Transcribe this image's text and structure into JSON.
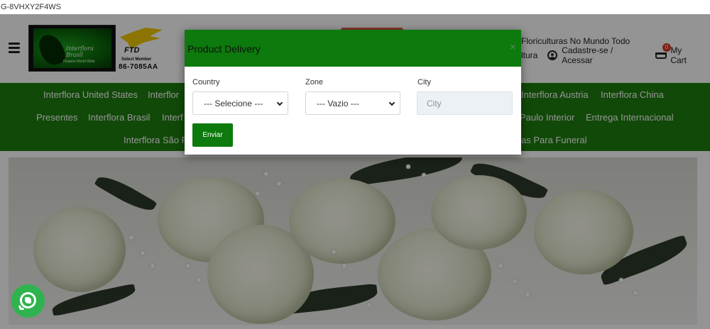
{
  "top_bar": {
    "code": "G-8VHXY2F4WS"
  },
  "header": {
    "logo": {
      "script_text": "Interflora Brasil",
      "base_text": "Flowers World Wide"
    },
    "ftd": {
      "brand": "FTD",
      "member_label": "Select Member",
      "member_number": "86-7085AA"
    },
    "tagline": "Floriculturas No Mundo Todo",
    "links": {
      "partial_link": "ltura",
      "account": "Cadastre-se / Acessar",
      "cart": "My Cart"
    },
    "cart_count": "0"
  },
  "nav": {
    "row1": {
      "left_1": "Interflora United States",
      "left_2": "Interflor",
      "right_1": "Interflora Austria",
      "right_2": "Interflora China"
    },
    "row2": {
      "left_1": "Presentes",
      "left_2": "Interflora Brasil",
      "left_3": "Interf",
      "right_1": "Paulo Interior",
      "right_2": "Entrega Internacional"
    },
    "row3": {
      "left_1": "Interflora São P",
      "right_1": "as Para Funeral"
    }
  },
  "modal": {
    "title": "Product Delivery",
    "close_symbol": "×",
    "country": {
      "label": "Country",
      "value": "--- Selecione ---"
    },
    "zone": {
      "label": "Zone",
      "value": "--- Vazio ---"
    },
    "city": {
      "label": "City",
      "placeholder": "City"
    },
    "submit_label": "Enviar"
  },
  "colors": {
    "brand_green": "#1e7e0e",
    "modal_header_green": "#0c7a0c",
    "cart_badge": "#d9372a",
    "whatsapp": "#2fb34f"
  },
  "icons": [
    "menu-icon",
    "user-icon",
    "cart-icon",
    "whatsapp-icon",
    "close-icon",
    "chevron-down-icon"
  ]
}
